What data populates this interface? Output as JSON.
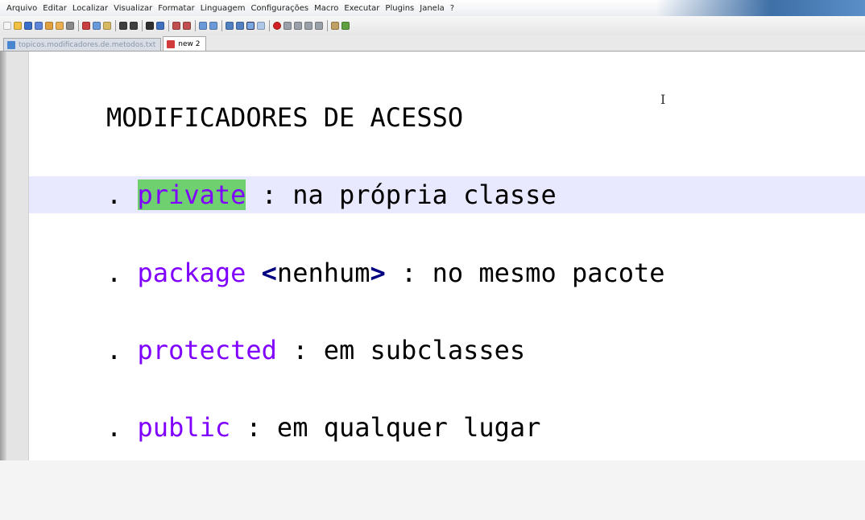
{
  "menu": [
    "Arquivo",
    "Editar",
    "Localizar",
    "Visualizar",
    "Formatar",
    "Linguagem",
    "Configurações",
    "Macro",
    "Executar",
    "Plugins",
    "Janela",
    "?"
  ],
  "tabs": [
    {
      "label": "topicos.modificadores.de.metodos.txt",
      "active": false
    },
    {
      "label": "new 2",
      "active": true
    }
  ],
  "editor": {
    "heading": "MODIFICADORES DE ACESSO",
    "lines": [
      {
        "bullet": ".",
        "keyword": "private",
        "sep": ":",
        "text": "na própria classe"
      },
      {
        "bullet": ".",
        "keyword": "package",
        "op_open": "<",
        "word": "nenhum",
        "op_close": ">",
        "sep": ":",
        "text": "no mesmo pacote"
      },
      {
        "bullet": ".",
        "keyword": "protected",
        "sep": ":",
        "text": "em subclasses"
      },
      {
        "bullet": ".",
        "keyword": "public",
        "sep": ":",
        "text": "em qualquer lugar"
      }
    ],
    "cursor_glyph": "I"
  },
  "colors": {
    "keyword": "#8000ff",
    "operator": "#000080",
    "selection": "#6ed06e",
    "current_line": "#e8e8ff"
  }
}
